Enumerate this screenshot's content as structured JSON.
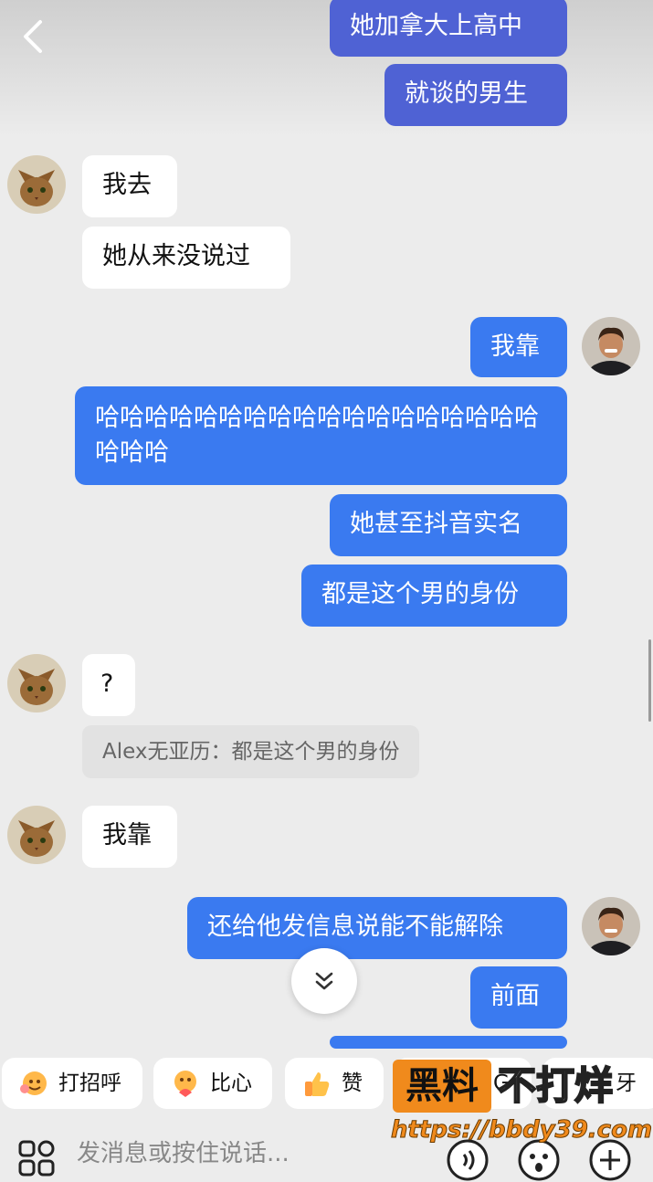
{
  "messages": [
    {
      "dir": "out",
      "text": "她加拿大上高中"
    },
    {
      "dir": "out",
      "text": "就谈的男生"
    },
    {
      "dir": "in",
      "text": "我去"
    },
    {
      "dir": "in",
      "text": "她从来没说过"
    },
    {
      "dir": "out",
      "text": "我靠"
    },
    {
      "dir": "out",
      "text": "哈哈哈哈哈哈哈哈哈哈哈哈哈哈哈哈哈哈哈哈哈"
    },
    {
      "dir": "out",
      "text": "她甚至抖音实名"
    },
    {
      "dir": "out",
      "text": "都是这个男的身份"
    },
    {
      "dir": "in",
      "text": "?"
    },
    {
      "dir": "in",
      "text": "我靠"
    },
    {
      "dir": "out",
      "text": "还给他发信息说能不能解除"
    },
    {
      "dir": "out",
      "text": "前面"
    }
  ],
  "quote": {
    "text": "Alex无亚历：都是这个男的身份"
  },
  "quick_replies": [
    {
      "label": "打招呼",
      "icon": "wave-emoji-icon"
    },
    {
      "label": "比心",
      "icon": "heart-hands-emoji-icon"
    },
    {
      "label": "赞",
      "icon": "thumbs-up-emoji-icon"
    },
    {
      "label": "G",
      "icon": "partial"
    },
    {
      "label": "牙",
      "icon": "partial"
    }
  ],
  "input": {
    "placeholder": "发消息或按住说话..."
  },
  "watermark": {
    "box_text": "黑料",
    "rest_text": "不打烊",
    "url": "https://bbdy39.com"
  },
  "colors": {
    "outgoing": "#3a7af0",
    "incoming": "#ffffff",
    "background": "#ececec",
    "watermark": "#f08a1c"
  }
}
